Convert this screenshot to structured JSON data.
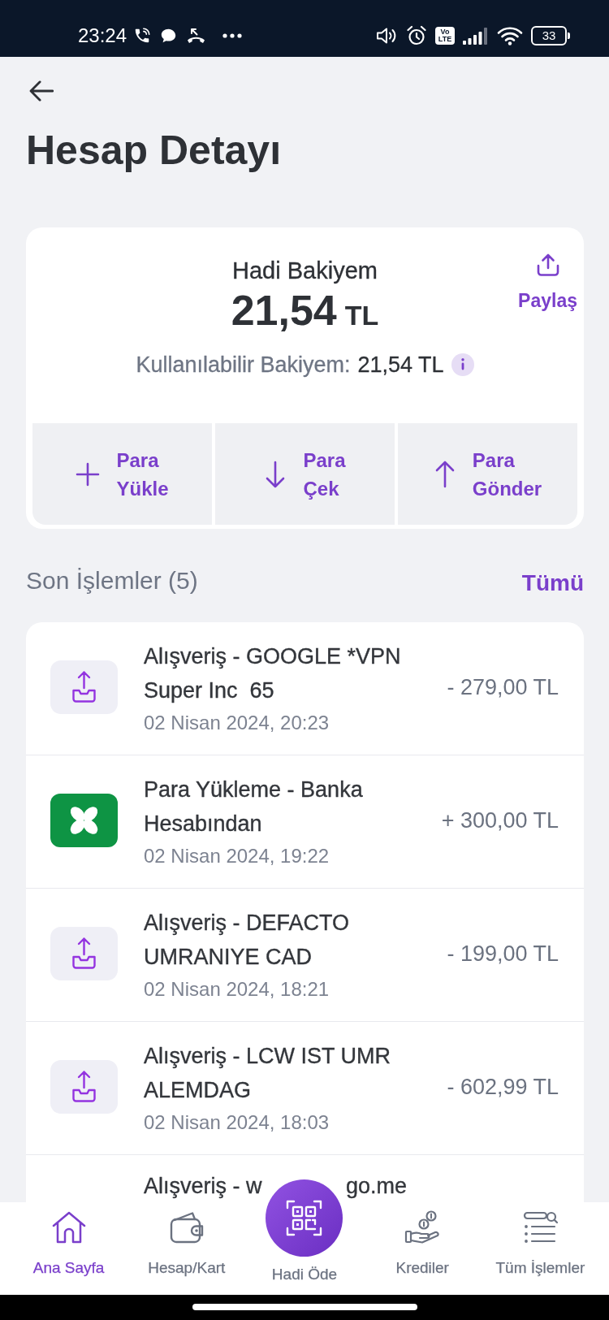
{
  "status_bar": {
    "time": "23:24",
    "network_badge": "Vo LTE",
    "battery": "33"
  },
  "header": {
    "title": "Hesap Detayı"
  },
  "balance_card": {
    "title": "Hadi Bakiyem",
    "amount": "21,54",
    "currency": "TL",
    "available_label": "Kullanılabilir Bakiyem:",
    "available_amount": "21,54 TL",
    "share_label": "Paylaş",
    "actions": [
      {
        "kind": "add",
        "label": "Para Yükle"
      },
      {
        "kind": "withdraw",
        "label": "Para Çek"
      },
      {
        "kind": "send",
        "label": "Para Gönder"
      }
    ]
  },
  "recent_transactions": {
    "title": "Son İşlemler (5)",
    "see_all": "Tümü",
    "items": [
      {
        "kind": "purchase",
        "title": "Alışveriş - GOOGLE *VPN Super Inc  65",
        "date": "02 Nisan 2024, 20:23",
        "amount": "- 279,00 TL"
      },
      {
        "kind": "bank_topup",
        "title": "Para Yükleme - Banka Hesabından",
        "date": "02 Nisan 2024, 19:22",
        "amount": "+ 300,00 TL"
      },
      {
        "kind": "purchase",
        "title": "Alışveriş - DEFACTO UMRANIYE CAD",
        "date": "02 Nisan 2024, 18:21",
        "amount": "- 199,00 TL"
      },
      {
        "kind": "purchase",
        "title": "Alışveriş - LCW IST UMR ALEMDAG",
        "date": "02 Nisan 2024, 18:03",
        "amount": "- 602,99 TL"
      },
      {
        "kind": "covered",
        "title_parts": [
          "Alışveriş - w",
          "go.me"
        ]
      }
    ]
  },
  "bottom_nav": {
    "items": [
      {
        "kind": "home",
        "label": "Ana Sayfa",
        "selected": true
      },
      {
        "kind": "wallet",
        "label": "Hesap/Kart",
        "selected": false
      },
      {
        "kind": "qr",
        "label": "Hadi Öde",
        "selected": false
      },
      {
        "kind": "loans",
        "label": "Krediler",
        "selected": false
      },
      {
        "kind": "list",
        "label": "Tüm İşlemler",
        "selected": false
      }
    ]
  }
}
